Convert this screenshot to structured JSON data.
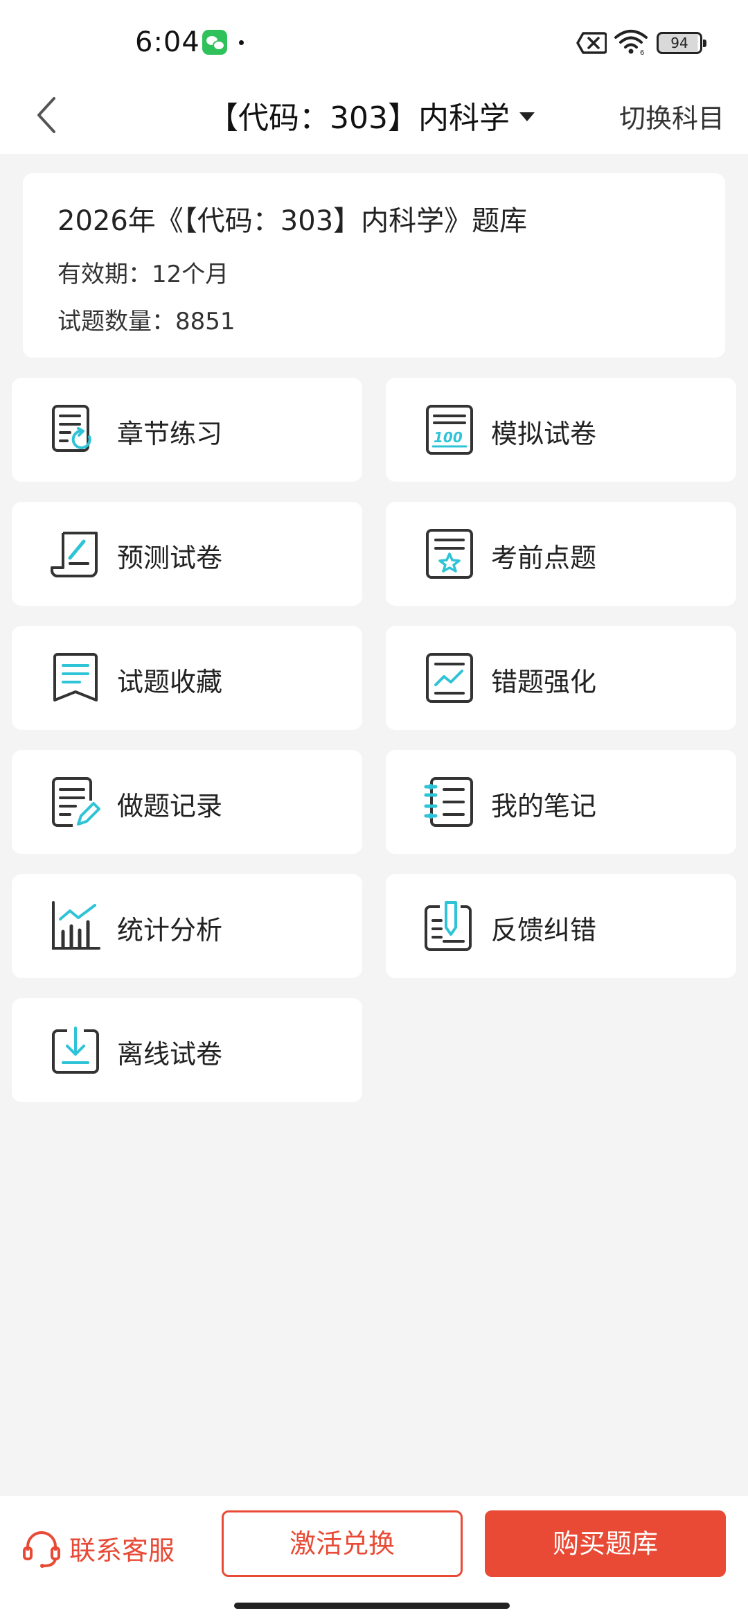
{
  "status_bar": {
    "time": "6:04",
    "battery": "94",
    "icons": [
      "wechat-icon",
      "sim-off-icon",
      "wifi-icon",
      "battery-icon"
    ]
  },
  "header": {
    "title": "【代码：303】内科学",
    "switch_label": "切换科目",
    "back_icon": "chevron-left-icon",
    "dropdown_icon": "caret-down-icon"
  },
  "info": {
    "title": "2026年《【代码：303】内科学》题库",
    "validity": "有效期：12个月",
    "count": "试题数量：8851"
  },
  "tiles": [
    {
      "label": "章节练习",
      "icon": "chapter-practice-icon"
    },
    {
      "label": "模拟试卷",
      "icon": "mock-exam-icon"
    },
    {
      "label": "预测试卷",
      "icon": "prediction-paper-icon"
    },
    {
      "label": "考前点题",
      "icon": "pre-exam-star-icon"
    },
    {
      "label": "试题收藏",
      "icon": "bookmark-icon"
    },
    {
      "label": "错题强化",
      "icon": "trend-chart-icon"
    },
    {
      "label": "做题记录",
      "icon": "record-edit-icon"
    },
    {
      "label": "我的笔记",
      "icon": "notebook-icon"
    },
    {
      "label": "统计分析",
      "icon": "bar-chart-icon"
    },
    {
      "label": "反馈纠错",
      "icon": "feedback-pen-icon"
    },
    {
      "label": "离线试卷",
      "icon": "download-icon"
    }
  ],
  "bottom": {
    "contact_label": "联系客服",
    "activate_label": "激活兑换",
    "buy_label": "购买题库",
    "contact_icon": "headset-icon"
  },
  "colors": {
    "accent": "#e84a35",
    "icon_accent": "#2ec3d6",
    "icon_dark": "#333333",
    "background": "#f4f4f4"
  }
}
